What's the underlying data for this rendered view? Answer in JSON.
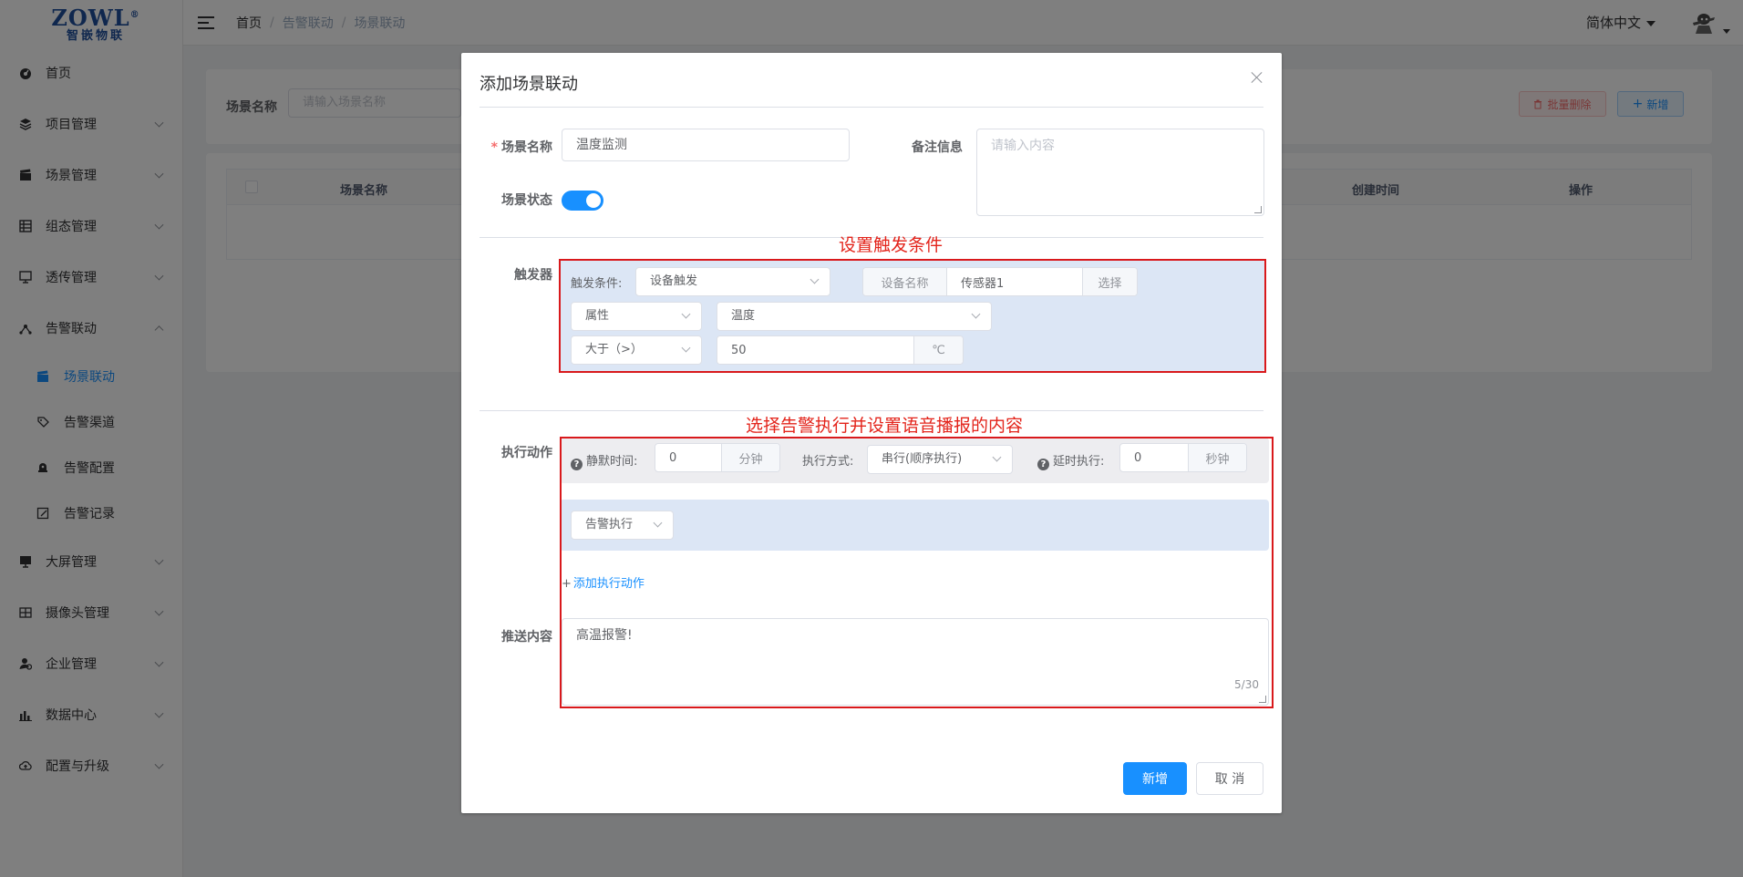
{
  "brand": {
    "logo_text": "ZOWL",
    "logo_reg": "®",
    "logo_subtitle": "智嵌物联"
  },
  "sidebar": {
    "items": [
      {
        "label": "首页",
        "icon": "dashboard-icon"
      },
      {
        "label": "项目管理",
        "icon": "layers-icon"
      },
      {
        "label": "场景管理",
        "icon": "clapper-icon"
      },
      {
        "label": "组态管理",
        "icon": "list-icon"
      },
      {
        "label": "透传管理",
        "icon": "monitor-icon"
      },
      {
        "label": "告警联动",
        "icon": "network-icon"
      }
    ],
    "subitems": [
      {
        "label": "场景联动",
        "icon": "clapper-icon"
      },
      {
        "label": "告警渠道",
        "icon": "tag-icon"
      },
      {
        "label": "告警配置",
        "icon": "bell-icon"
      },
      {
        "label": "告警记录",
        "icon": "edit-icon"
      }
    ],
    "items_after": [
      {
        "label": "大屏管理",
        "icon": "screen-icon"
      },
      {
        "label": "摄像头管理",
        "icon": "grid-icon"
      },
      {
        "label": "企业管理",
        "icon": "user-icon"
      },
      {
        "label": "数据中心",
        "icon": "chart-icon"
      },
      {
        "label": "配置与升级",
        "icon": "cloud-icon"
      }
    ]
  },
  "header": {
    "breadcrumb": [
      "首页",
      "告警联动",
      "场景联动"
    ],
    "breadcrumb_sep": "/",
    "language": "简体中文"
  },
  "search": {
    "label": "场景名称",
    "placeholder": "请输入场景名称"
  },
  "toolbar": {
    "batch_delete": "批量删除",
    "add": "新增"
  },
  "table": {
    "columns": [
      "场景名称",
      "创建时间",
      "操作"
    ]
  },
  "dialog": {
    "title": "添加场景联动",
    "name_label": "场景名称",
    "name_required": "*",
    "name_value": "温度监测",
    "remark_label": "备注信息",
    "remark_placeholder": "请输入内容",
    "status_label": "场景状态",
    "status_on": true,
    "note_trigger": "设置触发条件",
    "trigger": {
      "label": "触发器",
      "condition_label": "触发条件:",
      "condition_value": "设备触发",
      "device_prefix": "设备名称",
      "device_value": "传感器1",
      "device_select": "选择",
      "prop_type": "属性",
      "prop_value": "温度",
      "operator": "大于（>）",
      "threshold": "50",
      "unit": "℃"
    },
    "note_action": "选择告警执行并设置语音播报的内容",
    "action": {
      "label": "执行动作",
      "silence_label": "静默时间:",
      "silence_value": "0",
      "silence_unit": "分钟",
      "mode_label": "执行方式:",
      "mode_value": "串行(顺序执行)",
      "delay_label": "延时执行:",
      "delay_value": "0",
      "delay_unit": "秒钟",
      "action_type": "告警执行",
      "add_action_plus": "+",
      "add_action": "添加执行动作"
    },
    "push": {
      "label": "推送内容",
      "value": "高温报警!",
      "count": "5/30"
    },
    "buttons": {
      "confirm": "新增",
      "cancel": "取 消"
    }
  }
}
